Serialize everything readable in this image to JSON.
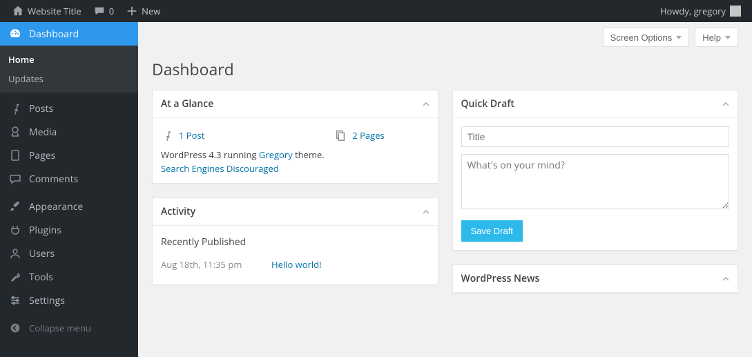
{
  "adminbar": {
    "site_title": "Website Title",
    "comment_count": "0",
    "new_label": "New",
    "howdy": "Howdy, gregory"
  },
  "sidebar": {
    "dashboard_label": "Dashboard",
    "sub_home": "Home",
    "sub_updates": "Updates",
    "items": [
      {
        "label": "Posts",
        "icon": "pin"
      },
      {
        "label": "Media",
        "icon": "media"
      },
      {
        "label": "Pages",
        "icon": "page"
      },
      {
        "label": "Comments",
        "icon": "comment"
      }
    ],
    "items2": [
      {
        "label": "Appearance",
        "icon": "brush"
      },
      {
        "label": "Plugins",
        "icon": "plug"
      },
      {
        "label": "Users",
        "icon": "user"
      },
      {
        "label": "Tools",
        "icon": "wrench"
      },
      {
        "label": "Settings",
        "icon": "settings"
      }
    ],
    "collapse": "Collapse menu"
  },
  "header": {
    "screen_options": "Screen Options",
    "help": "Help",
    "page_title": "Dashboard"
  },
  "glance": {
    "title": "At a Glance",
    "post_link": "1 Post",
    "page_link": "2 Pages",
    "version_prefix": "WordPress 4.3 running ",
    "theme_name": "Gregory",
    "version_suffix": " theme.",
    "search_discouraged": "Search Engines Discouraged"
  },
  "activity": {
    "title": "Activity",
    "recent_heading": "Recently Published",
    "rows": [
      {
        "time": "Aug 18th, 11:35 pm",
        "link": "Hello world!"
      }
    ]
  },
  "quickdraft": {
    "title": "Quick Draft",
    "title_placeholder": "Title",
    "content_placeholder": "What's on your mind?",
    "save_label": "Save Draft"
  },
  "news": {
    "title": "WordPress News"
  }
}
